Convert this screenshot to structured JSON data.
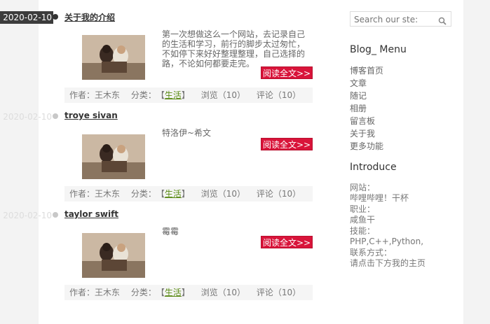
{
  "posts": [
    {
      "date": "2020-02-10",
      "title": "关于我的介绍",
      "excerpt": "第一次想做这么一个网站，去记录自己的生活和学习，前行的脚步太过匆忙，不如停下来好好整理整理，自己选择的路，不论如何都要走完。",
      "read_more": "阅读全文>>",
      "author_label": "作者：",
      "author": "王木东",
      "category_label": "分类：",
      "category": "生活",
      "views": "浏览（10）",
      "comments": "评论（10）"
    },
    {
      "date": "2020-02-10",
      "title": "troye sivan",
      "excerpt": "特洛伊~希文",
      "read_more": "阅读全文>>",
      "author_label": "作者：",
      "author": "王木东",
      "category_label": "分类：",
      "category": "生活",
      "views": "浏览（10）",
      "comments": "评论（10）"
    },
    {
      "date": "2020-02-10",
      "title": "taylor swift",
      "excerpt": "霉霉",
      "read_more": "阅读全文>>",
      "author_label": "作者：",
      "author": "王木东",
      "category_label": "分类：",
      "category": "生活",
      "views": "浏览（10）",
      "comments": "评论（10）"
    }
  ],
  "sidebar": {
    "search_placeholder": "Search our ste:",
    "search_icon": "magnifier-icon",
    "menu_title": "Blog_ Menu",
    "menu_items": [
      "博客首页",
      "文章",
      "随记",
      "相册",
      "留言板",
      "关于我",
      "更多功能"
    ],
    "intro_title": "Introduce",
    "intro": [
      {
        "label": "网站：",
        "value": "哔哩哔哩！干杯"
      },
      {
        "label": "职业：",
        "value": "咸鱼干"
      },
      {
        "label": "技能：",
        "value": "PHP,C++,Python,"
      },
      {
        "label": "联系方式：",
        "value": "请点击下方我的主页"
      }
    ]
  },
  "colors": {
    "accent_red": "#d9143a",
    "category_green": "#5a8a14",
    "date_tag_bg": "#3c3c3c"
  }
}
